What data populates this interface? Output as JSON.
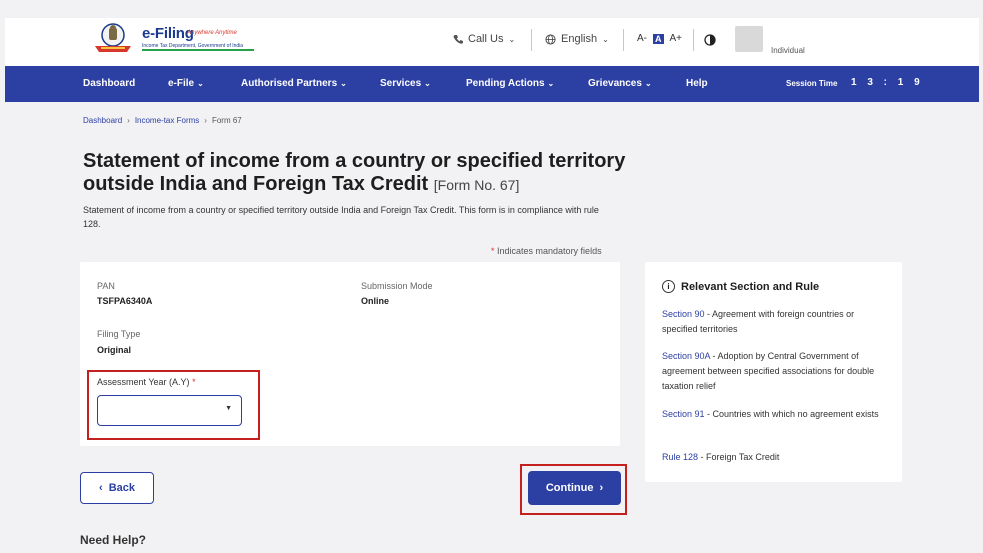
{
  "header": {
    "logo_title": "e-Filing",
    "logo_tagline": "Anywhere Anytime",
    "logo_subtitle": "Income Tax Department, Government of India",
    "call_us": "Call Us",
    "language": "English",
    "font_decrease": "A-",
    "font_default": "A",
    "font_increase": "A+",
    "user_role": "Individual"
  },
  "nav": {
    "items": [
      {
        "label": "Dashboard"
      },
      {
        "label": "e-File"
      },
      {
        "label": "Authorised Partners"
      },
      {
        "label": "Services"
      },
      {
        "label": "Pending Actions"
      },
      {
        "label": "Grievances"
      },
      {
        "label": "Help"
      }
    ],
    "session_label": "Session Time",
    "session_time": "1 3 : 1 9"
  },
  "breadcrumb": {
    "items": [
      "Dashboard",
      "Income-tax Forms"
    ],
    "current": "Form 67"
  },
  "page": {
    "title": "Statement of income from a country or specified territory outside India and Foreign Tax Credit",
    "form_no": "[Form No. 67]",
    "description": "Statement of income from a country or specified territory outside India and Foreign Tax Credit. This form is in compliance with rule 128.",
    "mandatory_note": "Indicates mandatory fields"
  },
  "form": {
    "pan_label": "PAN",
    "pan_value": "TSFPA6340A",
    "submission_mode_label": "Submission Mode",
    "submission_mode_value": "Online",
    "filing_type_label": "Filing Type",
    "filing_type_value": "Original",
    "assessment_year_label": "Assessment Year (A.Y)",
    "assessment_year_value": ""
  },
  "side_panel": {
    "title": "Relevant Section and Rule",
    "rules": [
      {
        "link": "Section 90",
        "text": " - Agreement with foreign countries or specified territories"
      },
      {
        "link": "Section 90A",
        "text": " - Adoption by Central Government of agreement between specified associations for double taxation relief"
      },
      {
        "link": "Section 91",
        "text": " - Countries with which no agreement exists"
      },
      {
        "link": "Rule 128",
        "text": " - Foreign Tax Credit"
      }
    ]
  },
  "actions": {
    "back_label": "Back",
    "continue_label": "Continue"
  },
  "footer": {
    "need_help": "Need Help?"
  },
  "colors": {
    "primary": "#2c3fa3",
    "highlight": "#c4201e",
    "background": "#f2f2f4"
  }
}
